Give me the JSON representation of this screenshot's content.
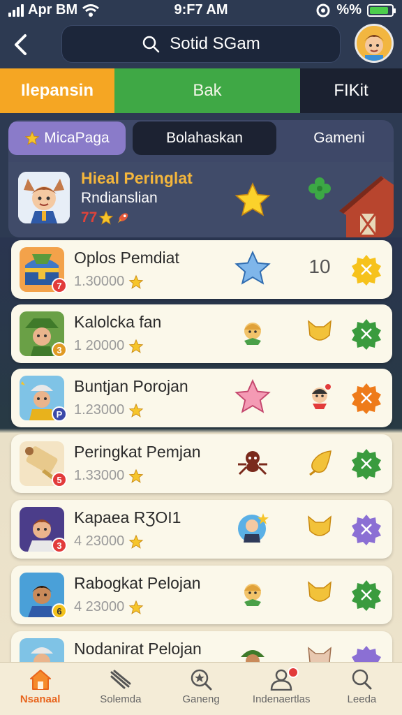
{
  "status": {
    "carrier": "Apr BM",
    "time": "9:F7 AM",
    "battery_text": "%%",
    "battery_level": 0.85
  },
  "header": {
    "back_icon": "back-arrow-icon",
    "search_text": "Sotid SGam"
  },
  "top_tabs": [
    {
      "label": "Ilepansin",
      "color": "#f5a623"
    },
    {
      "label": "Bak",
      "color": "#3fa845"
    },
    {
      "label": "FIKit",
      "color": "#1b2130"
    }
  ],
  "segments": [
    {
      "label": "MicaPaga",
      "icon": "star-icon",
      "active": true
    },
    {
      "label": "Bolahaskan",
      "active": false
    },
    {
      "label": "Gameni",
      "active": false
    }
  ],
  "hero": {
    "title": "Hieal Peringlat",
    "subtitle": "Rndianslian",
    "score": "77"
  },
  "rows": [
    {
      "name": "Oplos Pemdiat",
      "score": "1.30000",
      "badge": "7",
      "badge_color": "#e23b3b",
      "item": "blue-star-icon",
      "right_value": "10",
      "action_color": "#f6c21c",
      "thumb": "chest"
    },
    {
      "name": "Kalolcka fan",
      "score": "1 20000",
      "badge": "3",
      "badge_color": "#e09a24",
      "item": "character-icon",
      "right_item": "gold-cat-icon",
      "action_color": "#3a9b3e",
      "thumb": "hat"
    },
    {
      "name": "Buntjan Porojan",
      "score": "1.23000",
      "badge": "P",
      "badge_color": "#3b49a8",
      "item": "pink-star-icon",
      "right_item": "ninja-icon",
      "action_color": "#ee7b1a",
      "thumb": "builder"
    },
    {
      "name": "Peringkat Pemjan",
      "score": "1.33000",
      "badge": "5",
      "badge_color": "#e23b3b",
      "item": "spider-icon",
      "right_item": "gold-drop-icon",
      "action_color": "#3a9b3e",
      "thumb": "scroll"
    },
    {
      "name": "Kapaea RƷOI1",
      "score": "4 23000",
      "badge": "3",
      "badge_color": "#e23b3b",
      "item": "astronaut-icon",
      "right_item": "gold-cat-icon",
      "action_color": "#8b6fd4",
      "thumb": "man"
    },
    {
      "name": "Rabogkat Pelojan",
      "score": "4 23000",
      "badge": "6",
      "badge_color": "#f3c21c",
      "item": "character-icon",
      "right_item": "gold-cat-icon",
      "action_color": "#3a9b3e",
      "thumb": "man2"
    },
    {
      "name": "Nodanirat Pelojan",
      "score": "",
      "badge": "",
      "badge_color": "#e23b3b",
      "item": "soldier-icon",
      "right_item": "cat-icon",
      "action_color": "#8b6fd4",
      "thumb": "builder"
    }
  ],
  "bottom_nav": [
    {
      "label": "Nsanaal",
      "icon": "home-icon",
      "active": true
    },
    {
      "label": "Solemda",
      "icon": "feather-icon",
      "active": false
    },
    {
      "label": "Ganeng",
      "icon": "search-star-icon",
      "active": false
    },
    {
      "label": "Indenaertlas",
      "icon": "user-icon",
      "active": false,
      "has_dot": true
    },
    {
      "label": "Leeda",
      "icon": "search-icon",
      "active": false
    }
  ]
}
